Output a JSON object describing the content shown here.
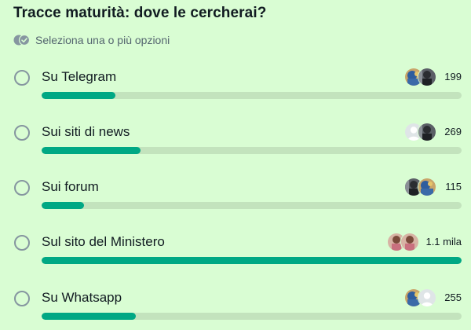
{
  "poll": {
    "question": "Tracce maturità: dove le cercherai?",
    "hint": "Seleziona una o più opzioni",
    "hint_icon": "double-check-icon",
    "accent_color": "#00a884",
    "options": [
      {
        "label": "Su Telegram",
        "count": "199",
        "fraction": 0.175,
        "avatars": [
          "photo-avatar-blue",
          "photo-avatar-dark"
        ]
      },
      {
        "label": "Sui siti di news",
        "count": "269",
        "fraction": 0.235,
        "avatars": [
          "default-avatar",
          "photo-avatar-dark"
        ]
      },
      {
        "label": "Sui forum",
        "count": "115",
        "fraction": 0.1,
        "avatars": [
          "photo-avatar-dark",
          "photo-avatar-blue"
        ]
      },
      {
        "label": "Sul sito del Ministero",
        "count": "1.1 mila",
        "fraction": 1.0,
        "avatars": [
          "photo-avatar-pink",
          "photo-avatar-pink"
        ]
      },
      {
        "label": "Su Whatsapp",
        "count": "255",
        "fraction": 0.225,
        "avatars": [
          "photo-avatar-blue",
          "default-avatar"
        ]
      }
    ]
  }
}
